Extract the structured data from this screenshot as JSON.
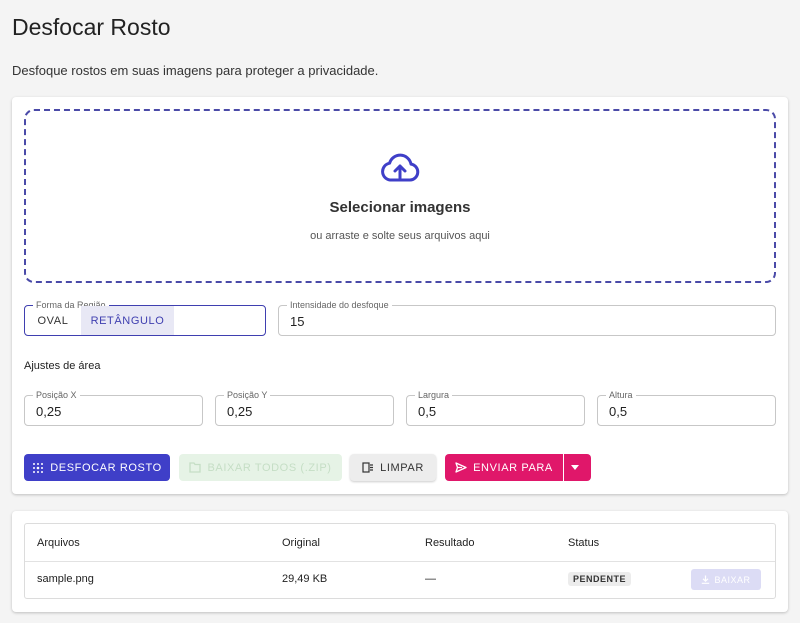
{
  "header": {
    "title": "Desfocar Rosto",
    "subtitle": "Desfoque rostos em suas imagens para proteger a privacidade."
  },
  "dropzone": {
    "icon": "cloud-upload-icon",
    "title": "Selecionar imagens",
    "hint": "ou arraste e solte seus arquivos aqui"
  },
  "shape": {
    "label": "Forma da Região",
    "options": [
      "OVAL",
      "RETÂNGULO"
    ],
    "selected": "RETÂNGULO"
  },
  "intensity": {
    "label": "Intensidade do desfoque",
    "value": "15"
  },
  "area": {
    "label": "Ajustes de área",
    "fields": [
      {
        "label": "Posição X",
        "value": "0,25"
      },
      {
        "label": "Posição Y",
        "value": "0,25"
      },
      {
        "label": "Largura",
        "value": "0,5"
      },
      {
        "label": "Altura",
        "value": "0,5"
      }
    ]
  },
  "actions": {
    "blur": "DESFOCAR ROSTO",
    "zip": "BAIXAR TODOS (.ZIP)",
    "clear": "LIMPAR",
    "send": "ENVIAR PARA"
  },
  "files": {
    "columns": [
      "Arquivos",
      "Original",
      "Resultado",
      "Status"
    ],
    "rows": [
      {
        "name": "sample.png",
        "original": "29,49 KB",
        "result": "—",
        "status": "PENDENTE",
        "action": "BAIXAR"
      }
    ]
  },
  "colors": {
    "primary": "#3f3fc8",
    "accent": "#e0176a",
    "dropzone_border": "#4a4aa8"
  }
}
